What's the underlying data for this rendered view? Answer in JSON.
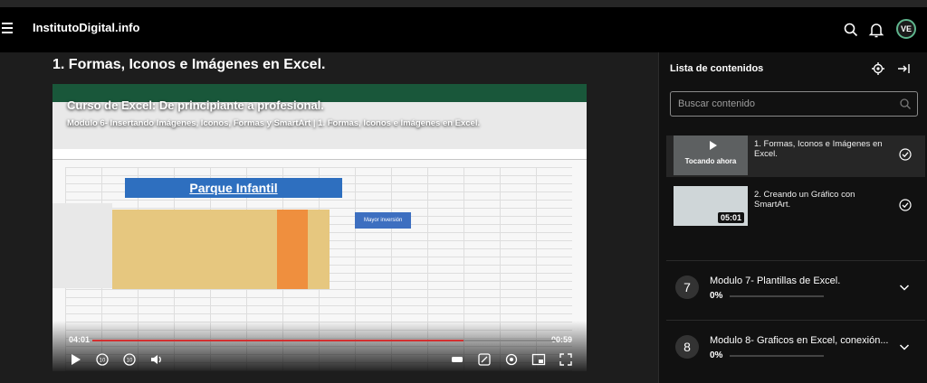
{
  "header": {
    "brand": "InstitutoDigital.info",
    "avatar_initials": "VE"
  },
  "lesson": {
    "title": "1. Formas, Iconos e Imágenes en Excel."
  },
  "video": {
    "overlay_title": "Curso de Excel: De principiante a profesional.",
    "overlay_subtitle": "Modulo 6- Insertando Imágenes, Iconos, Formas y SmartArt | 1. Formas, Iconos e Imágenes en Excel.",
    "sheet_banner": "Parque Infantil",
    "callout": "Mayor inversión",
    "time_current": "04:01",
    "time_remaining": "00:59",
    "progress": 0.8
  },
  "sidebar": {
    "title": "Lista de contenidos",
    "search_placeholder": "Buscar contenido",
    "lessons": [
      {
        "label": "1. Formas, Iconos e Imágenes en Excel.",
        "thumb_label": "Tocando ahora",
        "active": true
      },
      {
        "label": "2. Creando un Gráfico con SmartArt.",
        "duration": "05:01",
        "active": false
      }
    ],
    "modules": [
      {
        "number": "7",
        "title": "Modulo 7- Plantillas de Excel.",
        "progress": "0%"
      },
      {
        "number": "8",
        "title": "Modulo 8- Graficos en Excel, conexión...",
        "progress": "0%"
      }
    ]
  },
  "colors": {
    "accent": "#d32f2f",
    "avatar_ring": "#5fb58d",
    "background": "#1d1d1d"
  }
}
